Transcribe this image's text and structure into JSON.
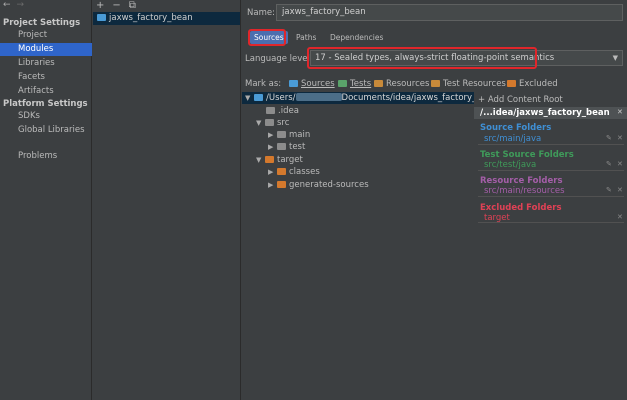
{
  "nav": {
    "back": "←",
    "forward": "→",
    "project_settings": "Project Settings",
    "project_items": [
      "Project",
      "Modules",
      "Libraries",
      "Facets",
      "Artifacts"
    ],
    "platform_settings": "Platform Settings",
    "platform_items": [
      "SDKs",
      "Global Libraries"
    ],
    "problems": "Problems"
  },
  "modules": {
    "add": "+",
    "remove": "−",
    "copy": "⧉",
    "item": "jaxws_factory_bean"
  },
  "name": {
    "label": "Name:",
    "value": "jaxws_factory_bean"
  },
  "tabs": [
    "Sources",
    "Paths",
    "Dependencies"
  ],
  "language": {
    "label": "Language level:",
    "value": "17 - Sealed types, always-strict floating-point semantics"
  },
  "mark_as": {
    "label": "Mark as:",
    "items": [
      "Sources",
      "Tests",
      "Resources",
      "Test Resources",
      "Excluded"
    ]
  },
  "tree": {
    "root_prefix": "/Users/",
    "root_suffix": "Documents/idea/jaxws_factory_bea",
    "idea": ".idea",
    "src": "src",
    "main": "main",
    "test": "test",
    "target": "target",
    "classes": "classes",
    "generated": "generated-sources"
  },
  "panel": {
    "add_root": "+ Add Content Root",
    "root": "/...idea/jaxws_factory_bean",
    "source_title": "Source Folders",
    "source_path": "src/main/java",
    "test_title": "Test Source Folders",
    "test_path": "src/test/java",
    "resource_title": "Resource Folders",
    "resource_path": "src/main/resources",
    "excluded_title": "Excluded Folders",
    "excluded_path": "target"
  },
  "colors": {
    "accent": "#2f65ca",
    "highlight_box": "#e0262b",
    "source": "#3f8fd4",
    "test": "#3f9b5a",
    "resource": "#a45ea8",
    "excluded": "#e04155"
  }
}
